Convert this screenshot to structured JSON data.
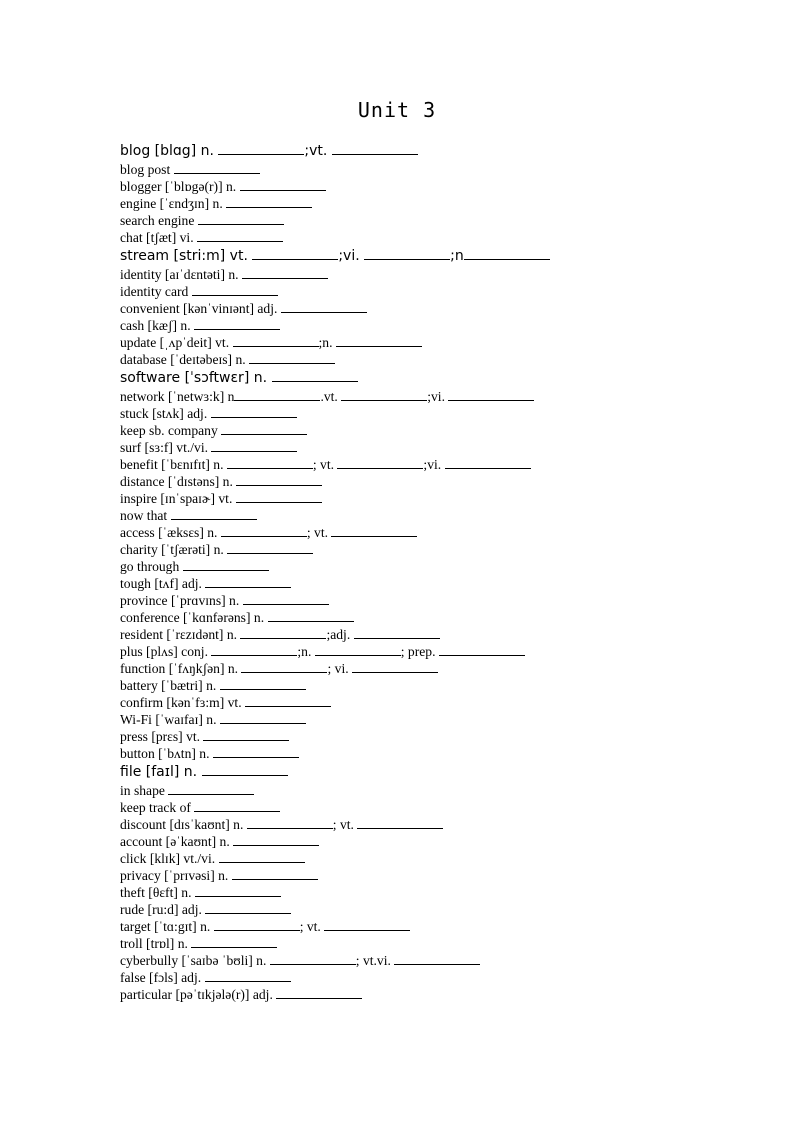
{
  "title": "Unit 3",
  "entries": [
    {
      "style": "sans",
      "parts": [
        "blog [blɑg] n. ",
        ";vt. ",
        ""
      ]
    },
    {
      "style": "serif",
      "parts": [
        "blog post ",
        ""
      ]
    },
    {
      "style": "serif",
      "parts": [
        "blogger [ˈblɒgə(r)] n. ",
        ""
      ]
    },
    {
      "style": "serif",
      "parts": [
        "engine [ˈɛndʒɪn] n. ",
        ""
      ]
    },
    {
      "style": "serif",
      "parts": [
        "search engine ",
        ""
      ]
    },
    {
      "style": "serif",
      "parts": [
        "chat [tʃæt] vi. ",
        ""
      ]
    },
    {
      "style": "sans",
      "parts": [
        "stream [stri:m] vt. ",
        ";vi. ",
        ";n",
        ""
      ]
    },
    {
      "style": "serif",
      "parts": [
        "identity [aɪˈdɛntəti] n. ",
        ""
      ]
    },
    {
      "style": "serif",
      "parts": [
        "identity card ",
        ""
      ]
    },
    {
      "style": "serif",
      "parts": [
        "convenient [kənˈvinɪənt] adj. ",
        ""
      ]
    },
    {
      "style": "serif",
      "parts": [
        "cash [kæʃ] n. ",
        ""
      ]
    },
    {
      "style": "serif",
      "parts": [
        "update [ˌʌpˈdeit] vt. ",
        ";n. ",
        ""
      ]
    },
    {
      "style": "serif",
      "parts": [
        "database [ˈdeɪtəbeɪs] n. ",
        ""
      ]
    },
    {
      "style": "sans",
      "parts": [
        "software [ˈsɔftwɛr] n. ",
        ""
      ]
    },
    {
      "style": "serif",
      "parts": [
        "network [ˈnetwɜ:k] n",
        ".vt. ",
        ";vi. ",
        ""
      ]
    },
    {
      "style": "serif",
      "parts": [
        "stuck [stʌk] adj. ",
        ""
      ]
    },
    {
      "style": "serif",
      "parts": [
        "keep sb. company ",
        ""
      ]
    },
    {
      "style": "serif",
      "parts": [
        "surf [sɜ:f] vt./vi. ",
        ""
      ]
    },
    {
      "style": "serif",
      "parts": [
        "benefit [ˈbɛnɪfɪt] n. ",
        "; vt. ",
        ";vi. ",
        ""
      ]
    },
    {
      "style": "serif",
      "parts": [
        "distance [ˈdɪstəns] n. ",
        ""
      ]
    },
    {
      "style": "serif",
      "parts": [
        "inspire [ɪnˈspaɪɚ] vt. ",
        ""
      ]
    },
    {
      "style": "serif",
      "parts": [
        "now that ",
        ""
      ]
    },
    {
      "style": "serif",
      "parts": [
        "access [ˈæksɛs] n. ",
        "; vt. ",
        ""
      ]
    },
    {
      "style": "serif",
      "parts": [
        "charity [ˈtʃærəti] n. ",
        ""
      ]
    },
    {
      "style": "serif",
      "parts": [
        "go through ",
        ""
      ]
    },
    {
      "style": "serif",
      "parts": [
        "tough [tʌf] adj. ",
        ""
      ]
    },
    {
      "style": "serif",
      "parts": [
        "province [ˈprɑvɪns] n. ",
        ""
      ]
    },
    {
      "style": "serif",
      "parts": [
        "conference [ˈkɑnfərəns] n. ",
        ""
      ]
    },
    {
      "style": "serif",
      "parts": [
        "resident [ˈrɛzɪdənt] n. ",
        ";adj. ",
        ""
      ]
    },
    {
      "style": "serif",
      "parts": [
        "plus [plʌs] conj. ",
        ";n. ",
        "; prep. ",
        ""
      ]
    },
    {
      "style": "serif",
      "parts": [
        "function [ˈfʌŋkʃən] n. ",
        "; vi. ",
        ""
      ]
    },
    {
      "style": "serif",
      "parts": [
        "battery [ˈbætri] n. ",
        ""
      ]
    },
    {
      "style": "serif",
      "parts": [
        "confirm [kənˈfɜ:m] vt. ",
        ""
      ]
    },
    {
      "style": "serif",
      "parts": [
        "Wi-Fi [ˈwaɪfaɪ] n. ",
        ""
      ]
    },
    {
      "style": "serif",
      "parts": [
        "press [prɛs] vt. ",
        ""
      ]
    },
    {
      "style": "serif",
      "parts": [
        "button [ˈbʌtn] n. ",
        ""
      ]
    },
    {
      "style": "sans",
      "parts": [
        "file [faɪl] n. ",
        ""
      ]
    },
    {
      "style": "serif",
      "parts": [
        "in shape ",
        ""
      ]
    },
    {
      "style": "serif",
      "parts": [
        "keep track of ",
        ""
      ]
    },
    {
      "style": "serif",
      "parts": [
        "discount [dɪsˈkaʊnt] n. ",
        "; vt. ",
        ""
      ]
    },
    {
      "style": "serif",
      "parts": [
        "account [əˈkaʊnt] n. ",
        ""
      ]
    },
    {
      "style": "serif",
      "parts": [
        "click [klɪk] vt./vi. ",
        ""
      ]
    },
    {
      "style": "serif",
      "parts": [
        "privacy [ˈprɪvəsi] n. ",
        ""
      ]
    },
    {
      "style": "serif",
      "parts": [
        "theft [θɛft] n. ",
        ""
      ]
    },
    {
      "style": "serif",
      "parts": [
        "rude [ru:d] adj. ",
        ""
      ]
    },
    {
      "style": "serif",
      "parts": [
        "target [ˈtɑ:gɪt] n. ",
        "; vt. ",
        ""
      ]
    },
    {
      "style": "serif",
      "parts": [
        "troll [trɒl] n. ",
        ""
      ]
    },
    {
      "style": "serif",
      "parts": [
        "cyberbully [ˈsaɪbə ˈbʊli] n. ",
        "; vt.vi. ",
        ""
      ]
    },
    {
      "style": "serif",
      "parts": [
        "false [fɔls] adj. ",
        ""
      ]
    },
    {
      "style": "serif",
      "parts": [
        "particular [pəˈtɪkjələ(r)] adj. ",
        ""
      ]
    }
  ]
}
